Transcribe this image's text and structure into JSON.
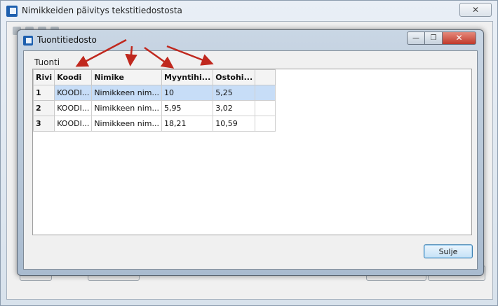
{
  "outer_window": {
    "title": "Nimikkeiden päivitys tekstitiedostosta",
    "close_label": "✕"
  },
  "dialog": {
    "title": "Tuontitiedosto",
    "minimize_label": "—",
    "maximize_label": "❐",
    "close_label": "✕",
    "section_label": "Tuonti",
    "close_button_label": "Sulje"
  },
  "grid": {
    "columns": [
      "Rivi",
      "Koodi",
      "Nimike",
      "Myyntihi...",
      "Ostohi..."
    ],
    "rows": [
      {
        "rivi": "1",
        "koodi": "KOODI...",
        "nimike": "Nimikkeen nim...",
        "myynti": "10",
        "osto": "5,25"
      },
      {
        "rivi": "2",
        "koodi": "KOODI...",
        "nimike": "Nimikkeen nim...",
        "myynti": "5,95",
        "osto": "3,02"
      },
      {
        "rivi": "3",
        "koodi": "KOODI...",
        "nimike": "Nimikkeen nim...",
        "myynti": "18,21",
        "osto": "10,59"
      }
    ],
    "selected_row": 1
  },
  "colors": {
    "annotation_arrow": "#c0281e",
    "selection": "#c7ddf7"
  }
}
